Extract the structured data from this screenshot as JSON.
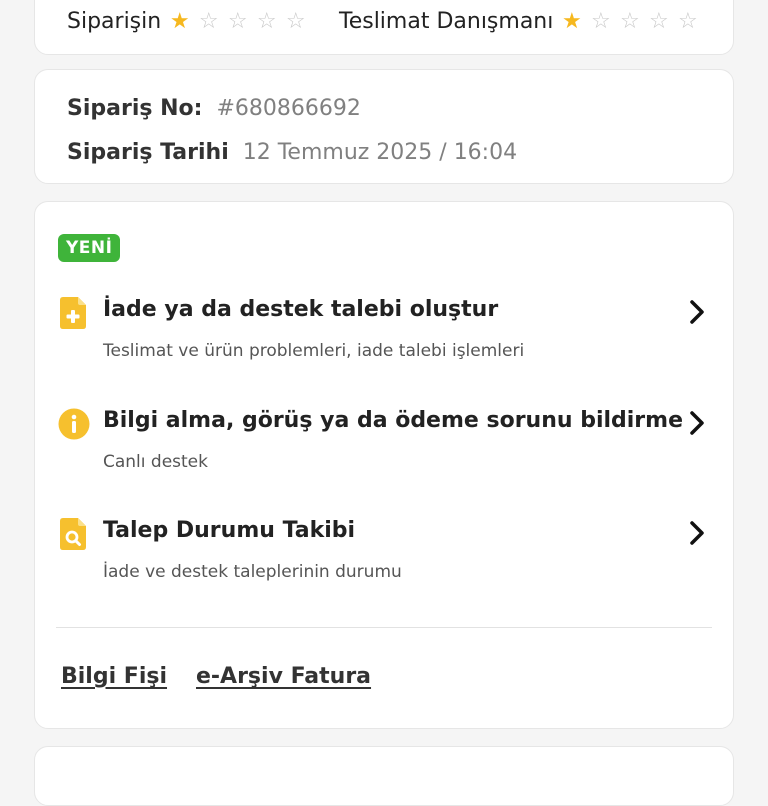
{
  "ratings": {
    "order_label": "Siparişin",
    "order_stars": 1,
    "courier_label": "Teslimat Danışmanı",
    "courier_stars": 1,
    "max_stars": 5
  },
  "order": {
    "number_label": "Sipariş No:",
    "number_value": "#680866692",
    "date_label": "Sipariş Tarihi",
    "date_value": "12 Temmuz 2025 / 16:04"
  },
  "support": {
    "badge": "YENİ",
    "actions": [
      {
        "title": "İade ya da destek talebi oluştur",
        "subtitle": "Teslimat ve ürün problemleri, iade talebi işlemleri",
        "icon": "document-plus-icon"
      },
      {
        "title": "Bilgi alma, görüş ya da ödeme sorunu bildirme",
        "subtitle": "Canlı destek",
        "icon": "info-circle-icon"
      },
      {
        "title": "Talep Durumu Takibi",
        "subtitle": "İade ve destek taleplerinin durumu",
        "icon": "document-search-icon"
      }
    ],
    "links": {
      "info_slip": "Bilgi Fişi",
      "e_archive_invoice": "e-Arşiv Fatura"
    }
  },
  "colors": {
    "accent_yellow": "#f6c02e",
    "star_filled": "#f6b81f",
    "badge_green": "#3fb43a"
  }
}
